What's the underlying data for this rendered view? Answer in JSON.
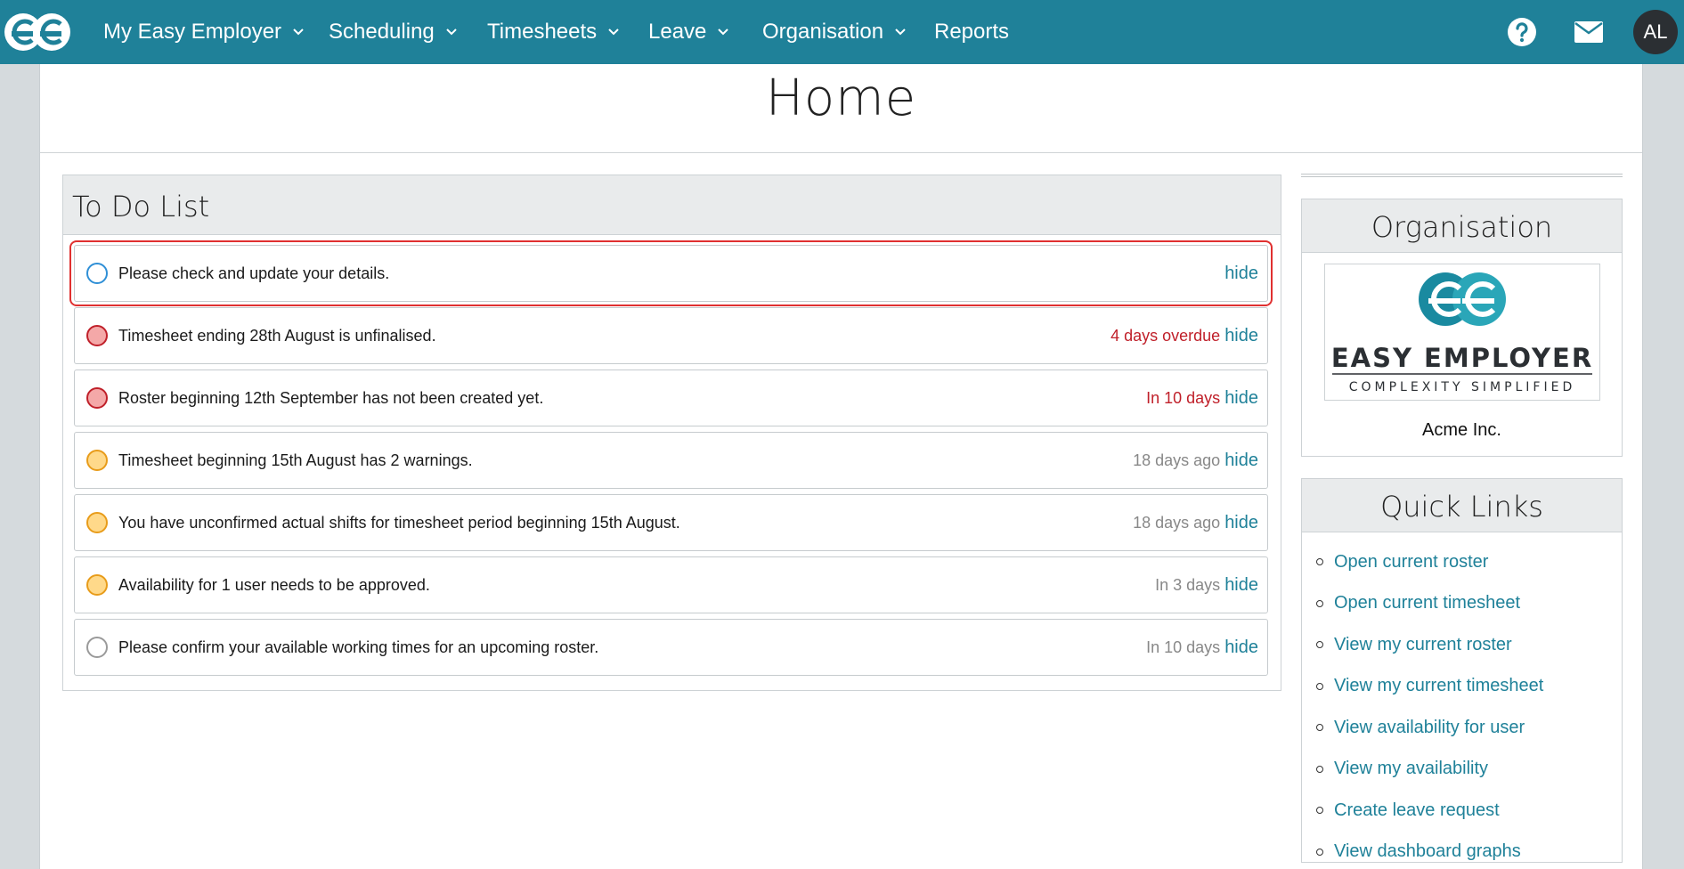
{
  "nav": {
    "items": [
      {
        "label": "My Easy Employer",
        "dropdown": true
      },
      {
        "label": "Scheduling",
        "dropdown": true
      },
      {
        "label": "Timesheets",
        "dropdown": true
      },
      {
        "label": "Leave",
        "dropdown": true
      },
      {
        "label": "Organisation",
        "dropdown": true
      },
      {
        "label": "Reports",
        "dropdown": false
      }
    ],
    "user_initials": "AL",
    "icons": [
      "help-icon",
      "mail-icon"
    ]
  },
  "page": {
    "title": "Home"
  },
  "todo": {
    "title": "To Do List",
    "hide_label": "hide",
    "items": [
      {
        "text": "Please check and update your details.",
        "when": "",
        "status": "info",
        "dot_fill": "#ffffff",
        "dot_border": "#2f8fd6",
        "when_color": "#888888"
      },
      {
        "text": "Timesheet ending 28th August is unfinalised.",
        "when": "4 days overdue",
        "status": "error",
        "dot_fill": "#f4a8a8",
        "dot_border": "#c0202a",
        "when_color": "#c0202a"
      },
      {
        "text": "Roster beginning 12th September has not been created yet.",
        "when": "In 10 days",
        "status": "error",
        "dot_fill": "#f4a8a8",
        "dot_border": "#c0202a",
        "when_color": "#c0202a"
      },
      {
        "text": "Timesheet beginning 15th August has 2 warnings.",
        "when": "18 days ago",
        "status": "warning",
        "dot_fill": "#ffd98a",
        "dot_border": "#e89c1a",
        "when_color": "#888888"
      },
      {
        "text": "You have unconfirmed actual shifts for timesheet period beginning 15th August.",
        "when": "18 days ago",
        "status": "warning",
        "dot_fill": "#ffd98a",
        "dot_border": "#e89c1a",
        "when_color": "#888888"
      },
      {
        "text": "Availability for 1 user needs to be approved.",
        "when": "In 3 days",
        "status": "warning",
        "dot_fill": "#ffd98a",
        "dot_border": "#e89c1a",
        "when_color": "#888888"
      },
      {
        "text": "Please confirm your available working times for an upcoming roster.",
        "when": "In 10 days",
        "status": "neutral",
        "dot_fill": "#ffffff",
        "dot_border": "#9a9a9a",
        "when_color": "#888888"
      }
    ]
  },
  "organisation": {
    "title": "Organisation",
    "logo_title": "EASY EMPLOYER",
    "logo_tagline": "COMPLEXITY SIMPLIFIED",
    "name": "Acme Inc."
  },
  "quick_links": {
    "title": "Quick Links",
    "items": [
      "Open current roster",
      "Open current timesheet",
      "View my current roster",
      "View my current timesheet",
      "View availability for user",
      "View my availability",
      "Create leave request",
      "View dashboard graphs"
    ]
  },
  "colors": {
    "nav_bg": "#1f8199",
    "link": "#1f8199",
    "selected_outline": "#e03030"
  }
}
